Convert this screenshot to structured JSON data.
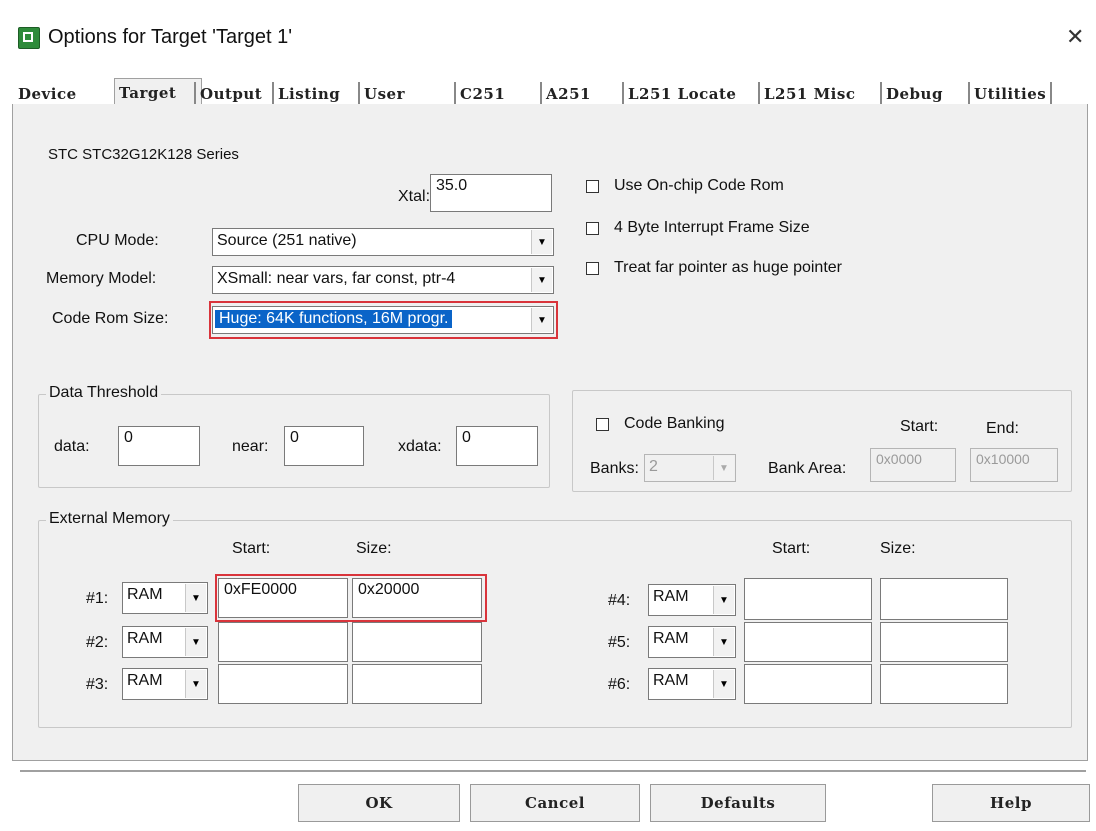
{
  "window": {
    "title": "Options for Target 'Target 1'",
    "close_glyph": "✕"
  },
  "tabs": [
    {
      "label": "Device"
    },
    {
      "label": "Target"
    },
    {
      "label": "Output"
    },
    {
      "label": "Listing"
    },
    {
      "label": "User"
    },
    {
      "label": "C251"
    },
    {
      "label": "A251"
    },
    {
      "label": "L251 Locate"
    },
    {
      "label": "L251 Misc"
    },
    {
      "label": "Debug"
    },
    {
      "label": "Utilities"
    }
  ],
  "active_tab": "Target",
  "device_name": "STC STC32G12K128 Series",
  "xtal": {
    "label": "Xtal:",
    "value": "35.0"
  },
  "cpu_mode": {
    "label": "CPU Mode:",
    "value": "Source (251 native)"
  },
  "memory_model": {
    "label": "Memory Model:",
    "value": "XSmall: near vars, far const, ptr-4"
  },
  "code_rom_size": {
    "label": "Code Rom Size:",
    "value": "Huge: 64K functions, 16M progr."
  },
  "checkboxes": [
    {
      "label": "Use On-chip Code Rom",
      "checked": false
    },
    {
      "label": "4 Byte Interrupt Frame Size",
      "checked": false
    },
    {
      "label": "Treat far pointer as huge pointer",
      "checked": false
    }
  ],
  "data_threshold": {
    "title": "Data Threshold",
    "data_label": "data:",
    "data_value": "0",
    "near_label": "near:",
    "near_value": "0",
    "xdata_label": "xdata:",
    "xdata_value": "0"
  },
  "code_banking": {
    "label": "Code Banking",
    "checked": false,
    "banks_label": "Banks:",
    "banks_value": "2",
    "bank_area_label": "Bank Area:",
    "start_label": "Start:",
    "start_value": "0x0000",
    "end_label": "End:",
    "end_value": "0x10000"
  },
  "external_memory": {
    "title": "External Memory",
    "start_header": "Start:",
    "size_header": "Size:",
    "rows": [
      {
        "label": "#1:",
        "type": "RAM",
        "start": "0xFE0000",
        "size": "0x20000"
      },
      {
        "label": "#2:",
        "type": "RAM",
        "start": "",
        "size": ""
      },
      {
        "label": "#3:",
        "type": "RAM",
        "start": "",
        "size": ""
      },
      {
        "label": "#4:",
        "type": "RAM",
        "start": "",
        "size": ""
      },
      {
        "label": "#5:",
        "type": "RAM",
        "start": "",
        "size": ""
      },
      {
        "label": "#6:",
        "type": "RAM",
        "start": "",
        "size": ""
      }
    ]
  },
  "buttons": {
    "ok": "OK",
    "cancel": "Cancel",
    "defaults": "Defaults",
    "help": "Help"
  },
  "colors": {
    "highlight": "#0a64c8",
    "annotation_red": "#d9343b",
    "panel_bg": "#f0f0f0"
  }
}
